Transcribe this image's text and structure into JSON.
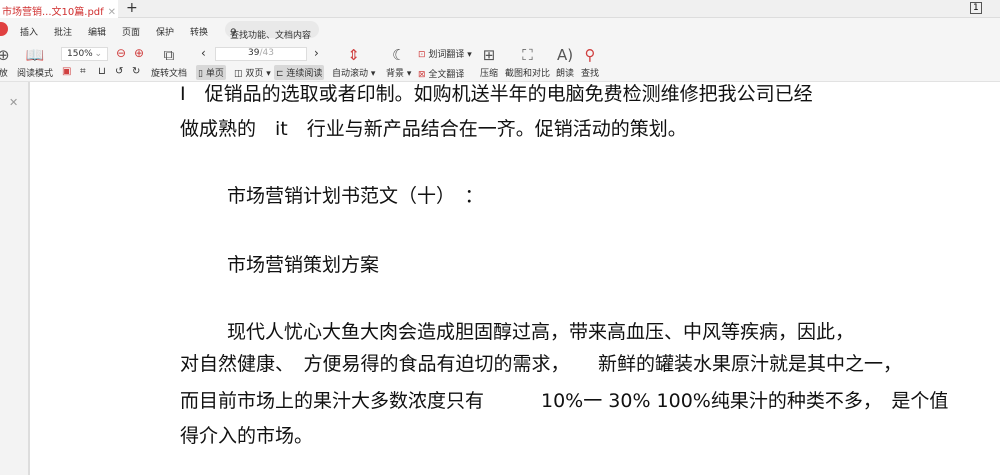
{
  "tab": {
    "title": "市场营销...文10篇.pdf",
    "new_tab": "+"
  },
  "menu": {
    "items": [
      "插入",
      "批注",
      "编辑",
      "页面",
      "保护",
      "转换"
    ],
    "search": "查找功能、文档内容"
  },
  "toolbar": {
    "zoom": "150%",
    "page_current": "39",
    "page_total": "/43",
    "read_mode": "阅读模式",
    "rotate": "旋转文档",
    "single": "单页",
    "double": "双页",
    "continuous": "连续阅读",
    "auto_scroll": "自动滚动",
    "background": "背景",
    "word_translate": "划词翻译",
    "full_translate": "全文翻译",
    "compress": "压缩",
    "screenshot": "截图和对比",
    "read_aloud": "朗读",
    "find": "查找",
    "left_cut": "放"
  },
  "document": {
    "lines": [
      "I　促销品的选取或者印制。如购机送半年的电脑免费检测维修把我公司已经",
      "做成熟的　it　行业与新产品结合在一齐。促销活动的策划。",
      "市场营销计划书范文（十）　：",
      "市场营销策划方案",
      "现代人忧心大鱼大肉会造成胆固醇过高，带来高血压、中风等疾病，因此，",
      "对自然健康、　方便易得的食品有迫切的需求，　　新鲜的罐装水果原汁就是其中之一，",
      "而目前市场上的果汁大多数浓度只有　　　10%一 30%  100%纯果汁的种类不多，　是个值",
      "得介入的市场。"
    ]
  }
}
